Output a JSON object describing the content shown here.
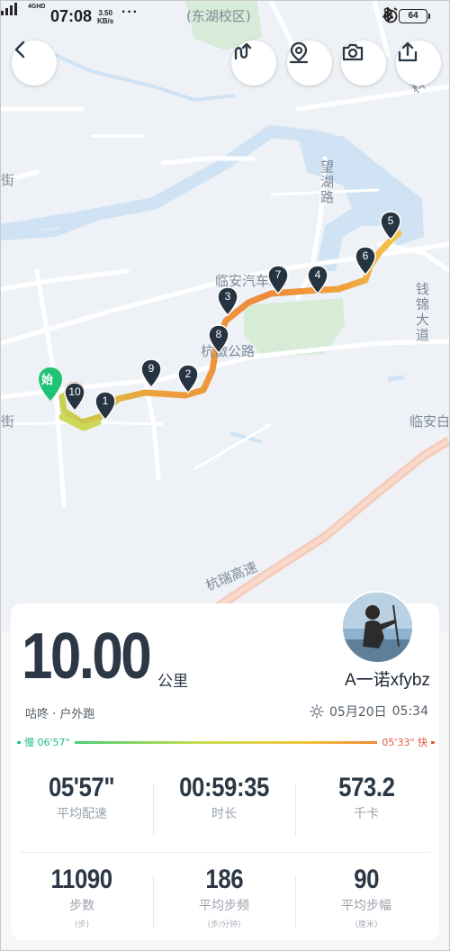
{
  "status_bar": {
    "network_tag": "4GHD",
    "time": "07:08",
    "speed_value": "3.50",
    "speed_unit": "KB/s",
    "more": "···",
    "network": "4G",
    "battery": "64"
  },
  "map": {
    "labels": {
      "campus": "(东湖校区)",
      "wanghu_road": "望湖路",
      "linan_station": "临安汽车站",
      "hangzhou_road": "杭徽公路",
      "qianjin_avenue": "钱锦大道",
      "hangrui_highway": "杭瑞高速",
      "linan_right": "临安白",
      "jie_left_top": "街",
      "jie_left_bottom": "街",
      "ke_top_right": "科",
      "start_marker": "始"
    },
    "km_markers": [
      "1",
      "2",
      "3",
      "4",
      "5",
      "6",
      "7",
      "8",
      "9",
      "10"
    ]
  },
  "toolbar": {
    "back_icon": "chevron-left-icon",
    "route_icon": "route-icon",
    "location_icon": "location-pin-icon",
    "camera_icon": "camera-icon",
    "share_icon": "share-icon"
  },
  "summary": {
    "distance": "10.00",
    "distance_unit": "公里",
    "username": "A一诺xfybz",
    "sport_type": "咕咚 · 户外跑",
    "date": "05月20日",
    "time": "05:34",
    "pace_slow": "慢 06'57\"",
    "pace_fast": "05'33\" 快",
    "colors": {
      "slow": "#16c38c",
      "fast": "#e2573b",
      "route_orange": "#ee9a3c"
    }
  },
  "stats": [
    {
      "value": "05'57\"",
      "label": "平均配速"
    },
    {
      "value": "00:59:35",
      "label": "时长"
    },
    {
      "value": "573.2",
      "label": "千卡"
    },
    {
      "value": "11090",
      "label": "步数",
      "sub": "(步)"
    },
    {
      "value": "186",
      "label": "平均步频",
      "sub": "(步/分钟)"
    },
    {
      "value": "90",
      "label": "平均步幅",
      "sub": "(厘米)"
    }
  ]
}
